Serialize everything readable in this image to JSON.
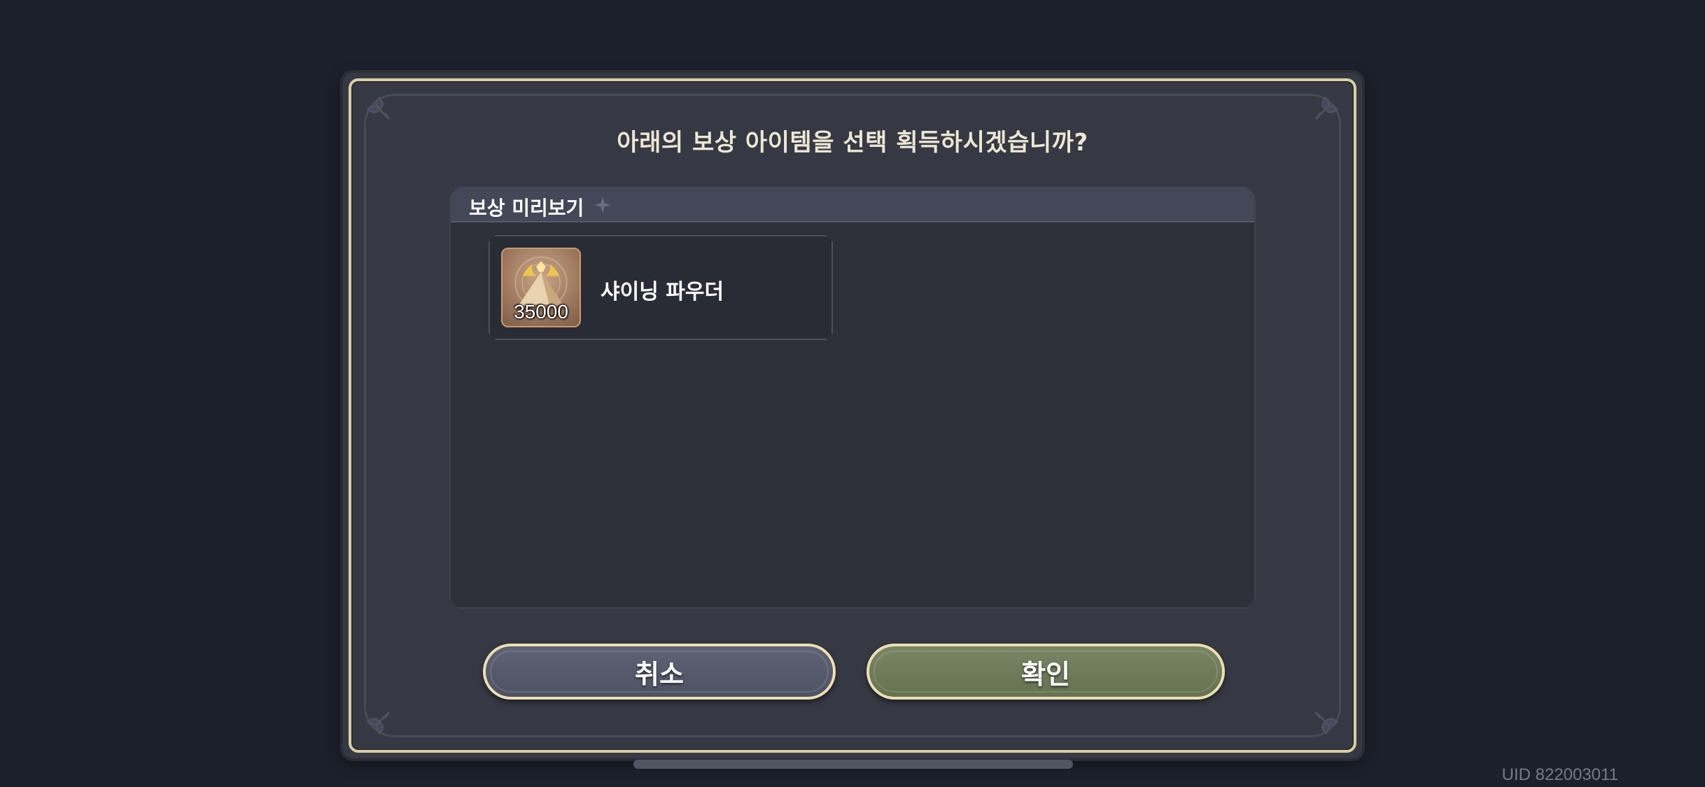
{
  "dialog": {
    "title": "아래의 보상 아이템을 선택 획득하시겠습니까?"
  },
  "preview": {
    "header_label": "보상 미리보기",
    "header_icon": "sparkle-icon",
    "items": [
      {
        "name": "샤이닝 파우더",
        "quantity": "35000",
        "icon": "shining-powder-icon"
      }
    ]
  },
  "buttons": {
    "cancel_label": "취소",
    "confirm_label": "확인"
  },
  "footer": {
    "uid": "UID 822003011"
  },
  "colors": {
    "background": "#1c202b",
    "dialog": "#363843",
    "frame_gold": "#d9cfa3",
    "cancel_button": "#5e6274",
    "confirm_button": "#7a8566"
  }
}
